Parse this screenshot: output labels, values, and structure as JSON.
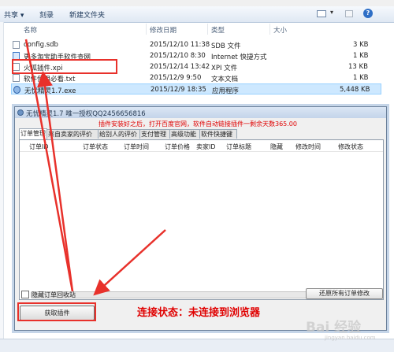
{
  "toolbar": {
    "share_label": "共享 ▾",
    "burn_label": "刻录",
    "new_folder_label": "新建文件夹"
  },
  "columns": {
    "name": "名称",
    "date": "修改日期",
    "type": "类型",
    "size": "大小"
  },
  "files": [
    {
      "name": "config.sdb",
      "date": "2015/12/10 11:38",
      "type": "SDB 文件",
      "size": "3 KB"
    },
    {
      "name": "更多淘宝助手软件查网",
      "date": "2015/12/10 8:30",
      "type": "Internet 快捷方式",
      "size": "1 KB"
    },
    {
      "name": "火狐插件.xpi",
      "date": "2015/12/14 13:42",
      "type": "XPI 文件",
      "size": "13 KB"
    },
    {
      "name": "软件使用必看.txt",
      "date": "2015/12/9 9:50",
      "type": "文本文档",
      "size": "1 KB"
    },
    {
      "name": "无忧精灵1.7.exe",
      "date": "2015/12/9 18:35",
      "type": "应用程序",
      "size": "5,448 KB"
    }
  ],
  "dialog": {
    "title": "无忧精灵1.7  唯一授权QQ2456656816",
    "notice": "插件安装好之后，打开百度官网，软件自动链接插件一剩余天数365.00",
    "tabs": [
      "订单管理",
      "来自卖家的评价",
      "给别人的评价",
      "支付管理",
      "高级功能",
      "软件快捷键"
    ],
    "grid_columns": [
      "订单ID",
      "订单状态",
      "订单时间",
      "订单价格",
      "卖家ID",
      "订单标题",
      "隐藏",
      "修改时间",
      "修改状态"
    ],
    "hide_recycle_label": "隐藏订单回收站",
    "restore_label": "还原所有订单修改",
    "get_plugin_label": "获取插件",
    "connection_status": "连接状态：未连接到浏览器"
  },
  "watermark": {
    "main": "Bai 经验",
    "sub": "jingyan.baidu.com"
  },
  "colors": {
    "annotation": "#e8312b",
    "notice_text": "#e00000",
    "selection": "#cde8ff"
  },
  "icons": [
    "dropdown-icon",
    "view-icon",
    "help-icon",
    "file-icon",
    "internet-shortcut-icon",
    "exe-icon",
    "checkbox-icon"
  ]
}
